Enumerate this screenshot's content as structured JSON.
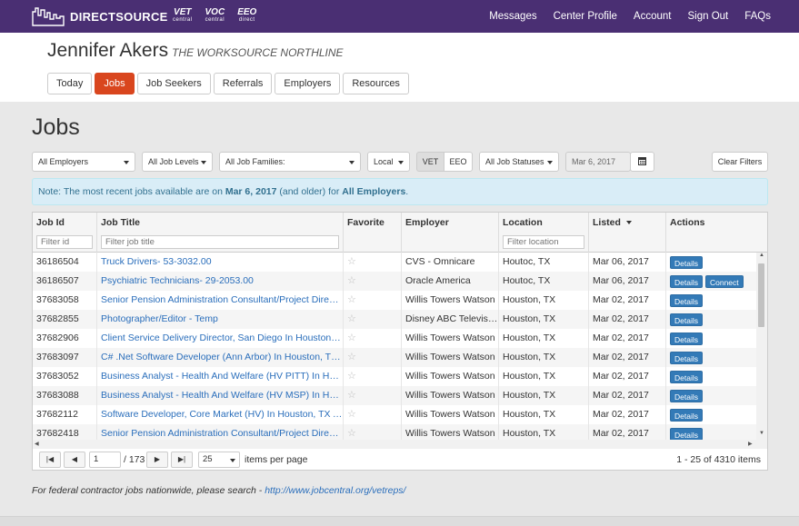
{
  "brand": {
    "name": "DIRECTSOURCE",
    "partners": [
      {
        "name": "VET",
        "sub": "central"
      },
      {
        "name": "VOC",
        "sub": "central"
      },
      {
        "name": "EEO",
        "sub": "direct"
      }
    ]
  },
  "topnav": [
    "Messages",
    "Center Profile",
    "Account",
    "Sign Out",
    "FAQs"
  ],
  "user": {
    "name": "Jennifer Akers",
    "org": "THE WORKSOURCE NORTHLINE"
  },
  "tabs": [
    "Today",
    "Jobs",
    "Job Seekers",
    "Referrals",
    "Employers",
    "Resources"
  ],
  "active_tab": "Jobs",
  "page_title": "Jobs",
  "filters": {
    "employers": "All Employers",
    "levels": "All Job Levels",
    "families": "All Job Families:",
    "local": "Local",
    "vet": "VET",
    "eeo": "EEO",
    "statuses": "All Job Statuses",
    "date": "Mar 6, 2017",
    "clear": "Clear Filters"
  },
  "note": {
    "pre": "Note: The most recent jobs available are on ",
    "date": "Mar 6, 2017",
    "mid": " (and older) for ",
    "who": "All Employers",
    "post": "."
  },
  "columns": {
    "id": "Job Id",
    "title": "Job Title",
    "fav": "Favorite",
    "employer": "Employer",
    "location": "Location",
    "listed": "Listed",
    "actions": "Actions"
  },
  "placeholders": {
    "id": "Filter id",
    "title": "Filter job title",
    "location": "Filter location"
  },
  "rows": [
    {
      "id": "36186504",
      "title": "Truck Drivers- 53-3032.00",
      "employer": "CVS - Omnicare",
      "location": "Houtoc, TX",
      "listed": "Mar 06, 2017",
      "actions": [
        "Details"
      ]
    },
    {
      "id": "36186507",
      "title": "Psychiatric Technicians- 29-2053.00",
      "employer": "Oracle America",
      "location": "Houtoc, TX",
      "listed": "Mar 06, 2017",
      "actions": [
        "Details",
        "Connect"
      ]
    },
    {
      "id": "37683058",
      "title": "Senior Pension Administration Consultant/Project Director In Houston",
      "employer": "Willis Towers Watson",
      "location": "Houston, TX",
      "listed": "Mar 02, 2017",
      "actions": [
        "Details"
      ]
    },
    {
      "id": "37682855",
      "title": "Photographer/Editor - Temp",
      "employer": "Disney ABC Television Group",
      "location": "Houston, TX",
      "listed": "Mar 02, 2017",
      "actions": [
        "Details"
      ]
    },
    {
      "id": "37682906",
      "title": "Client Service Delivery Director, San Diego In Houston, TX",
      "employer": "Willis Towers Watson",
      "location": "Houston, TX",
      "listed": "Mar 02, 2017",
      "actions": [
        "Details"
      ]
    },
    {
      "id": "37683097",
      "title": "C# .Net Software Developer (Ann Arbor) In Houston, TX At Willis",
      "employer": "Willis Towers Watson",
      "location": "Houston, TX",
      "listed": "Mar 02, 2017",
      "actions": [
        "Details"
      ]
    },
    {
      "id": "37683052",
      "title": "Business Analyst - Health And Welfare (HV PITT) In Houston, TX",
      "employer": "Willis Towers Watson",
      "location": "Houston, TX",
      "listed": "Mar 02, 2017",
      "actions": [
        "Details"
      ]
    },
    {
      "id": "37683088",
      "title": "Business Analyst - Health And Welfare (HV MSP) In Houston, TX",
      "employer": "Willis Towers Watson",
      "location": "Houston, TX",
      "listed": "Mar 02, 2017",
      "actions": [
        "Details"
      ]
    },
    {
      "id": "37682112",
      "title": "Software Developer, Core Market (HV) In Houston, TX At Willis",
      "employer": "Willis Towers Watson",
      "location": "Houston, TX",
      "listed": "Mar 02, 2017",
      "actions": [
        "Details"
      ]
    },
    {
      "id": "37682418",
      "title": "Senior Pension Administration Consultant/Project Director In Houston",
      "employer": "Willis Towers Watson",
      "location": "Houston, TX",
      "listed": "Mar 02, 2017",
      "actions": [
        "Details"
      ]
    }
  ],
  "pager": {
    "page": "1",
    "total": "/ 173",
    "per_page": "25",
    "per_page_label": "items per page",
    "range": "1 - 25 of 4310 items"
  },
  "footer": {
    "text": "For federal contractor jobs nationwide, please search - ",
    "link": "http://www.jobcentral.org/vetreps/"
  }
}
